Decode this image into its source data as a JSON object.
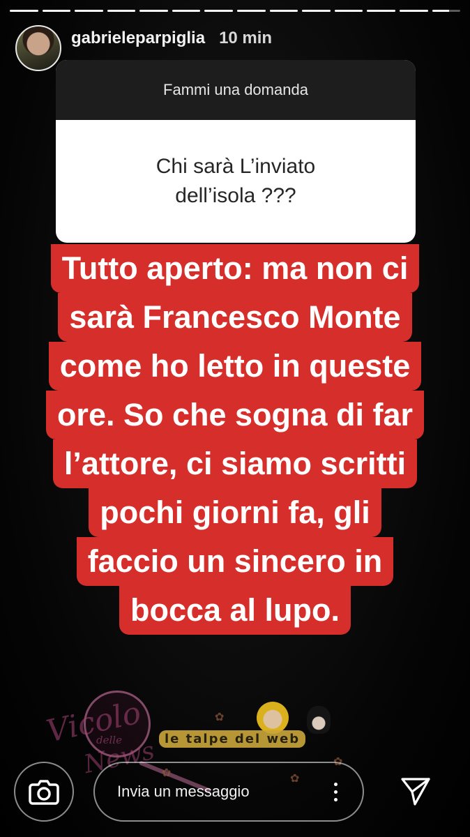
{
  "story": {
    "segments": 14,
    "current_segment": 14,
    "current_progress": 0.6
  },
  "header": {
    "username": "gabrieleparpiglia",
    "time": "10 min"
  },
  "question": {
    "title": "Fammi una domanda",
    "text": "Chi sarà L’inviato\ndell’isola ???"
  },
  "answer": {
    "lines": [
      "Tutto aperto: ma non ci",
      "sarà Francesco Monte",
      "come ho letto in queste",
      "ore. So che sogna di far",
      "l’attore, ci siamo scritti",
      "pochi giorni fa, gli",
      "faccio un sincero in",
      "bocca al lupo."
    ],
    "highlight_color": "#d62e2b"
  },
  "watermarks": {
    "vicolo": "Vicolo",
    "delle": "delle",
    "news": "News",
    "talpe": "le talpe del web"
  },
  "footer": {
    "message_placeholder": "Invia un messaggio",
    "camera_icon": "camera-icon",
    "more_icon": "more-vertical-icon",
    "send_icon": "send-icon"
  }
}
